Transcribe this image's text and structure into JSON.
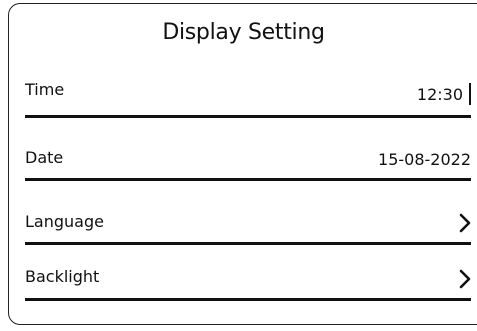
{
  "screen": {
    "title": "Display Setting"
  },
  "rows": [
    {
      "label": "Time",
      "value": "12:30"
    },
    {
      "label": "Date",
      "value": "15-08-2022"
    },
    {
      "label": "Language",
      "icon": "chevron-right-icon"
    },
    {
      "label": "Backlight",
      "icon": "chevron-right-icon"
    }
  ]
}
